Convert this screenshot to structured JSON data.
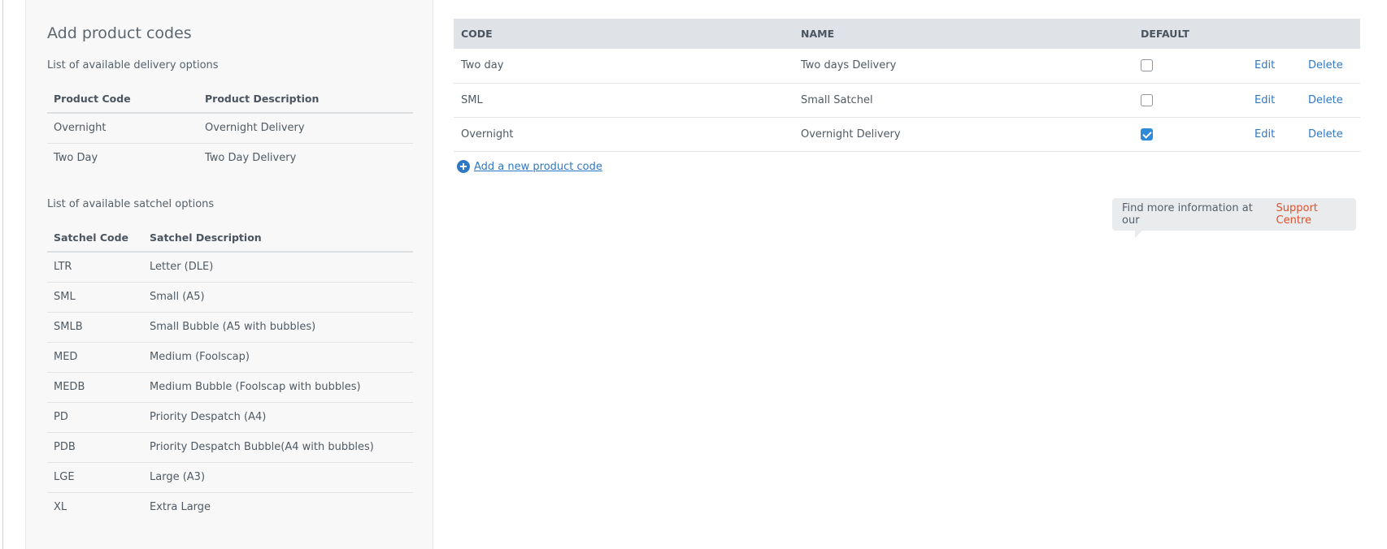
{
  "left_panel": {
    "title": "Add product codes",
    "delivery_label": "List of available delivery options",
    "delivery_table": {
      "headers": [
        "Product Code",
        "Product Description"
      ],
      "rows": [
        [
          "Overnight",
          "Overnight Delivery"
        ],
        [
          "Two Day",
          "Two Day Delivery"
        ]
      ]
    },
    "satchel_label": "List of available satchel options",
    "satchel_table": {
      "headers": [
        "Satchel Code",
        "Satchel Description"
      ],
      "rows": [
        [
          "LTR",
          "Letter (DLE)"
        ],
        [
          "SML",
          "Small (A5)"
        ],
        [
          "SMLB",
          "Small Bubble (A5 with bubbles)"
        ],
        [
          "MED",
          "Medium (Foolscap)"
        ],
        [
          "MEDB",
          "Medium Bubble (Foolscap with bubbles)"
        ],
        [
          "PD",
          "Priority Despatch (A4)"
        ],
        [
          "PDB",
          "Priority Despatch Bubble(A4 with bubbles)"
        ],
        [
          "LGE",
          "Large (A3)"
        ],
        [
          "XL",
          "Extra Large"
        ]
      ]
    }
  },
  "codes_table": {
    "headers": {
      "code": "CODE",
      "name": "NAME",
      "default": "DEFAULT"
    },
    "rows": [
      {
        "code": "Two day",
        "name": "Two days Delivery",
        "default": false,
        "edit": "Edit",
        "delete": "Delete"
      },
      {
        "code": "SML",
        "name": "Small Satchel",
        "default": false,
        "edit": "Edit",
        "delete": "Delete"
      },
      {
        "code": "Overnight",
        "name": "Overnight Delivery",
        "default": true,
        "edit": "Edit",
        "delete": "Delete"
      }
    ]
  },
  "add_link": {
    "label": "Add a new product code",
    "icon": "plus-circle-icon"
  },
  "info": {
    "text": "Find more information at our",
    "link": "Support Centre"
  },
  "colors": {
    "accent": "#2f78c4",
    "checked": "#2f8ad8",
    "support_link": "#e0522c",
    "table_header": "#dfe3e8"
  }
}
